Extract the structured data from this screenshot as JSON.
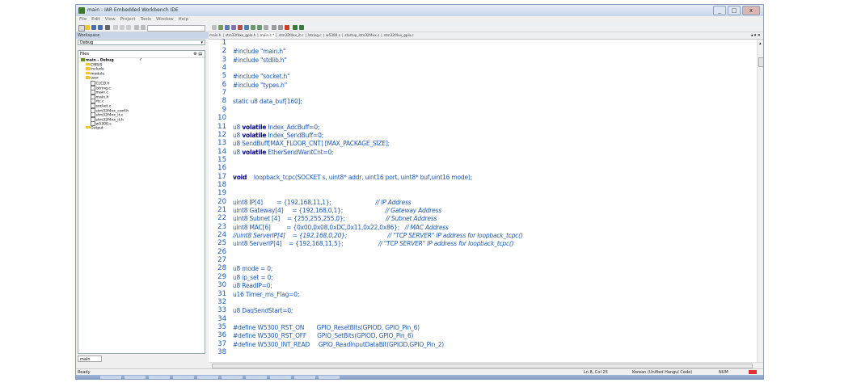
{
  "window": {
    "title": "main - IAR Embedded Workbench IDE",
    "buttons": {
      "minimize": "_",
      "maximize": "□",
      "close": "x"
    }
  },
  "menubar": [
    "File",
    "Edit",
    "View",
    "Project",
    "Tools",
    "Window",
    "Help"
  ],
  "workspace": {
    "header": "Workspace",
    "config": "Debug",
    "files_label": "Files",
    "tree": [
      {
        "label": "main - Debug",
        "icon": "proj",
        "indent": 0,
        "check": "✓",
        "bold": true
      },
      {
        "label": "CMSIS",
        "icon": "folder",
        "indent": 1
      },
      {
        "label": "include",
        "icon": "folder",
        "indent": 1
      },
      {
        "label": "module",
        "icon": "folder",
        "indent": 1
      },
      {
        "label": "user",
        "icon": "folder",
        "indent": 1
      },
      {
        "label": "CLCD.h",
        "icon": "file",
        "indent": 2
      },
      {
        "label": "lstring.c",
        "icon": "file",
        "indent": 2
      },
      {
        "label": "main.c",
        "icon": "file",
        "indent": 2
      },
      {
        "label": "main.h",
        "icon": "file",
        "indent": 2
      },
      {
        "label": "rtc.c",
        "icon": "file",
        "indent": 2
      },
      {
        "label": "socket.c",
        "icon": "file",
        "indent": 2
      },
      {
        "label": "stm32f4xx_conf.h",
        "icon": "file",
        "indent": 2
      },
      {
        "label": "stm32f4xx_it.c",
        "icon": "file",
        "indent": 2
      },
      {
        "label": "stm32f4xx_it.h",
        "icon": "file",
        "indent": 2
      },
      {
        "label": "w5300.c",
        "icon": "file",
        "indent": 2
      },
      {
        "label": "Output",
        "icon": "folder",
        "indent": 1
      }
    ],
    "bottom_tab": "main"
  },
  "editor_tabs": [
    "main.h",
    "stm32f4xx_gpio.h",
    "main.c *",
    "stm32f4xx_it.c",
    "lstring.c",
    "w5300.c",
    "startup_stm32f4xx.s",
    "stm32f4xx_gpio.c"
  ],
  "active_tab_index": 2,
  "code_lines": [
    {
      "n": "1",
      "segs": []
    },
    {
      "n": "2",
      "segs": [
        {
          "t": "#include \"main.h\"",
          "c": "pp"
        }
      ]
    },
    {
      "n": "3",
      "segs": [
        {
          "t": "#include \"stdlib.h\"",
          "c": "pp"
        }
      ]
    },
    {
      "n": "4",
      "segs": []
    },
    {
      "n": "5",
      "segs": [
        {
          "t": "#include \"socket.h\"",
          "c": "pp"
        }
      ]
    },
    {
      "n": "6",
      "segs": [
        {
          "t": "#include \"types.h\"",
          "c": "pp"
        }
      ]
    },
    {
      "n": "7",
      "segs": []
    },
    {
      "n": "8",
      "segs": [
        {
          "t": "static u8 data_buf[160];",
          "c": ""
        }
      ]
    },
    {
      "n": "9",
      "segs": []
    },
    {
      "n": "10",
      "segs": []
    },
    {
      "n": "11",
      "segs": [
        {
          "t": "u8 ",
          "c": ""
        },
        {
          "t": "volatile",
          "c": "kw"
        },
        {
          "t": " Index_AdcBuff=0;",
          "c": ""
        }
      ]
    },
    {
      "n": "12",
      "segs": [
        {
          "t": "u8 ",
          "c": ""
        },
        {
          "t": "volatile",
          "c": "kw"
        },
        {
          "t": " Index_SendBuff=0;",
          "c": ""
        }
      ]
    },
    {
      "n": "13",
      "segs": [
        {
          "t": "u8 SendBuff[MAX_FLOOR_CNT] [MAX_PACKAGE_SIZE];",
          "c": ""
        }
      ]
    },
    {
      "n": "14",
      "segs": [
        {
          "t": "u8 ",
          "c": ""
        },
        {
          "t": "volatile",
          "c": "kw"
        },
        {
          "t": " EtherSendWantCnt=0;",
          "c": ""
        }
      ]
    },
    {
      "n": "15",
      "segs": []
    },
    {
      "n": "16",
      "segs": []
    },
    {
      "n": "17",
      "segs": [
        {
          "t": "void",
          "c": "kw"
        },
        {
          "t": "    loopback_tcpc(SOCKET s, uint8* addr, uint16 port, uint8* buf,uint16 mode);",
          "c": ""
        }
      ]
    },
    {
      "n": "18",
      "segs": []
    },
    {
      "n": "19",
      "segs": []
    },
    {
      "n": "20",
      "segs": [
        {
          "t": "uint8 IP[4]        = {192,168,11,1};                         ",
          "c": ""
        },
        {
          "t": "// IP Address",
          "c": "cm"
        }
      ]
    },
    {
      "n": "21",
      "segs": [
        {
          "t": "uint8 Gateway[4]     = {192,168,0,1};                        ",
          "c": ""
        },
        {
          "t": "// Gateway Address",
          "c": "cm"
        }
      ]
    },
    {
      "n": "22",
      "segs": [
        {
          "t": "uint8 Subnet [4]    = {255,255,255,0};                       ",
          "c": ""
        },
        {
          "t": "// Subnet Address",
          "c": "cm"
        }
      ]
    },
    {
      "n": "23",
      "segs": [
        {
          "t": "uint8 MAC[6]         = {0x00,0x08,0xDC,0x11,0x22,0x86};   ",
          "c": ""
        },
        {
          "t": "// MAC Address",
          "c": "cm"
        }
      ]
    },
    {
      "n": "24",
      "segs": [
        {
          "t": "//uint8 ServerIP[4]    = {192,168,0,20};                       // \"TCP SERVER\" IP address for loopback_tcpc()",
          "c": "cm"
        }
      ]
    },
    {
      "n": "25",
      "segs": [
        {
          "t": "uint8 ServerIP[4]    = {192,168,11,5};                    ",
          "c": ""
        },
        {
          "t": "// \"TCP SERVER\" IP address for loopback_tcpc()",
          "c": "cm"
        }
      ]
    },
    {
      "n": "26",
      "segs": []
    },
    {
      "n": "27",
      "segs": []
    },
    {
      "n": "28",
      "segs": [
        {
          "t": "u8 mode = 0;",
          "c": ""
        }
      ]
    },
    {
      "n": "29",
      "segs": [
        {
          "t": "u8 ip_set = 0;",
          "c": ""
        }
      ]
    },
    {
      "n": "30",
      "segs": [
        {
          "t": "u8 ReadIP=0;",
          "c": ""
        }
      ]
    },
    {
      "n": "31",
      "segs": [
        {
          "t": "u16 Timer_ms_Flag=0;",
          "c": ""
        }
      ]
    },
    {
      "n": "32",
      "segs": []
    },
    {
      "n": "33",
      "segs": [
        {
          "t": "u8 DaqSendStart=0;",
          "c": ""
        }
      ]
    },
    {
      "n": "34",
      "segs": []
    },
    {
      "n": "35",
      "segs": [
        {
          "t": "#define W5300_RST_ON       GPIO_ResetBits(GPIOD, GPIO_Pin_6)",
          "c": "pp"
        }
      ]
    },
    {
      "n": "36",
      "segs": [
        {
          "t": "#define W5300_RST_OFF      GPIO_SetBits(GPIOD, GPIO_Pin_6)",
          "c": "pp"
        }
      ]
    },
    {
      "n": "37",
      "segs": [
        {
          "t": "#define W5300_INT_READ     GPIO_ReadInputDataBit(GPIOD,GPIO_Pin_2)",
          "c": "pp"
        }
      ]
    },
    {
      "n": "38",
      "segs": []
    }
  ],
  "statusbar": {
    "left": "Ready",
    "position": "Ln 8, Col 25",
    "encoding": "Korean (Unified Hangul Code)",
    "numlock": "NUM"
  },
  "colors": {
    "line_numbers": "#1e5ab0",
    "keyword": "#000080",
    "code": "#1e5ab0"
  }
}
